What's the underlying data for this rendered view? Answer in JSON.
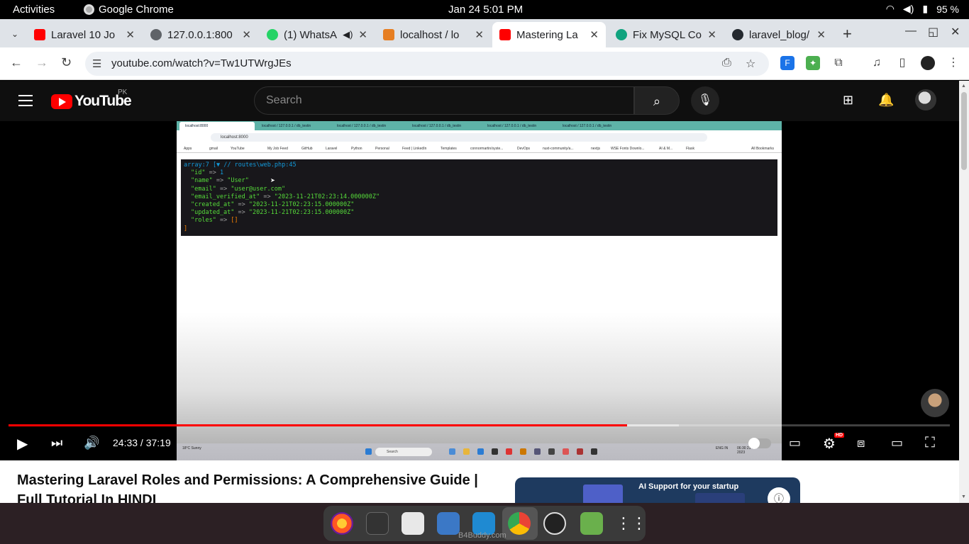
{
  "system": {
    "activities": "Activities",
    "app_name": "Google Chrome",
    "clock": "Jan 24   5:01 PM",
    "battery": "95 %"
  },
  "tabs": [
    {
      "title": "Laravel 10 Jo",
      "fav_color": "#ff0000"
    },
    {
      "title": "127.0.0.1:800",
      "fav_color": "#5f6368"
    },
    {
      "title": "(1) WhatsA",
      "fav_color": "#25d366"
    },
    {
      "title": "localhost / lo",
      "fav_color": "#e67e22"
    },
    {
      "title": "Mastering La",
      "fav_color": "#ff0000"
    },
    {
      "title": "Fix MySQL Co",
      "fav_color": "#10a37f"
    },
    {
      "title": "laravel_blog/",
      "fav_color": "#24292f"
    }
  ],
  "address": {
    "url": "youtube.com/watch?v=Tw1UTWrgJEs"
  },
  "youtube": {
    "logo_text": "YouTube",
    "country_code": "PK",
    "search_placeholder": "Search"
  },
  "inner_screen": {
    "tabs": [
      "localhost:8000",
      "localhost / 127.0.0.1 / db_testin",
      "localhost / 127.0.0.1 / db_testin",
      "localhost / 127.0.0.1 / db_testin",
      "localhost / 127.0.0.1 / db_testin",
      "localhost / 127.0.0.1 / db_testin"
    ],
    "url": "localhost:8000",
    "bookmarks": [
      "Apps",
      "gmail",
      "YouTube",
      "My Job Feed",
      "GitHub",
      "Laravel",
      "Python",
      "Personal",
      "Feed | LinkedIn",
      "Templates",
      "connormartin/syste...",
      "DevOps",
      "nuxt-community/a...",
      "nextjs",
      "WSE Fonts Downlo...",
      "AI & M...",
      "Flask",
      "All Bookmarks"
    ],
    "dump_header": "array:7 [▼ // routes\\web.php:45",
    "dump_rows": [
      {
        "key": "\"id\"",
        "value": "1",
        "type": "number"
      },
      {
        "key": "\"name\"",
        "value": "\"User\"",
        "type": "string"
      },
      {
        "key": "\"email\"",
        "value": "\"user@user.com\"",
        "type": "string"
      },
      {
        "key": "\"email_verified_at\"",
        "value": "\"2023-11-21T02:23:14.000000Z\"",
        "type": "string"
      },
      {
        "key": "\"created_at\"",
        "value": "\"2023-11-21T02:23:15.000000Z\"",
        "type": "string"
      },
      {
        "key": "\"updated_at\"",
        "value": "\"2023-11-21T02:23:15.000000Z\"",
        "type": "string"
      },
      {
        "key": "\"roles\"",
        "value": "[]",
        "type": "array"
      }
    ],
    "dump_close": "]",
    "weather": "18°C Sunny",
    "taskbar_search": "Search",
    "tray_lang": "ENG IN",
    "tray_time": "06:30 21-11-2023"
  },
  "player": {
    "time": "24:33 / 37:19",
    "played_fraction": 0.657,
    "buffered_fraction": 0.712,
    "hd_badge": "HD"
  },
  "video": {
    "title": "Mastering Laravel Roles and Permissions: A Comprehensive Guide | Full Tutorial In HINDI"
  },
  "ad": {
    "headline": "AI Support for your startup"
  },
  "dock": {
    "watermark": "B4Buddy.com"
  }
}
